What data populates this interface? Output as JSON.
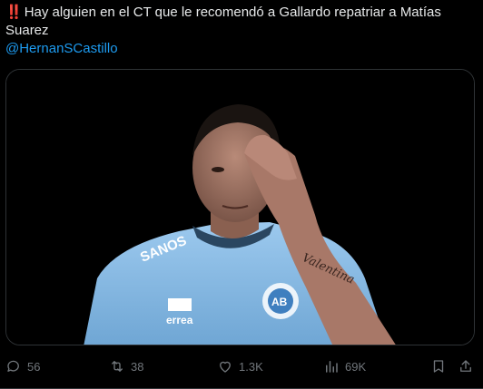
{
  "tweet": {
    "alert_icon": "‼️",
    "text": "Hay alguien en el CT que le recomendó a Gallardo repatriar a Matías Suarez",
    "mention": "@HernanSCastillo"
  },
  "photo": {
    "jersey_sponsor": "SANOS",
    "jersey_brand": "errea",
    "crest_text": "AB",
    "tattoo_text": "Valentina",
    "icon": "person-photo"
  },
  "actions": {
    "reply_count": "56",
    "retweet_count": "38",
    "like_count": "1.3K",
    "views_count": "69K"
  },
  "colors": {
    "background": "#000000",
    "text": "#e7e9ea",
    "link": "#1d9bf0",
    "muted": "#71767b",
    "alert": "#f4212e",
    "jersey": "#8ec0e8"
  }
}
